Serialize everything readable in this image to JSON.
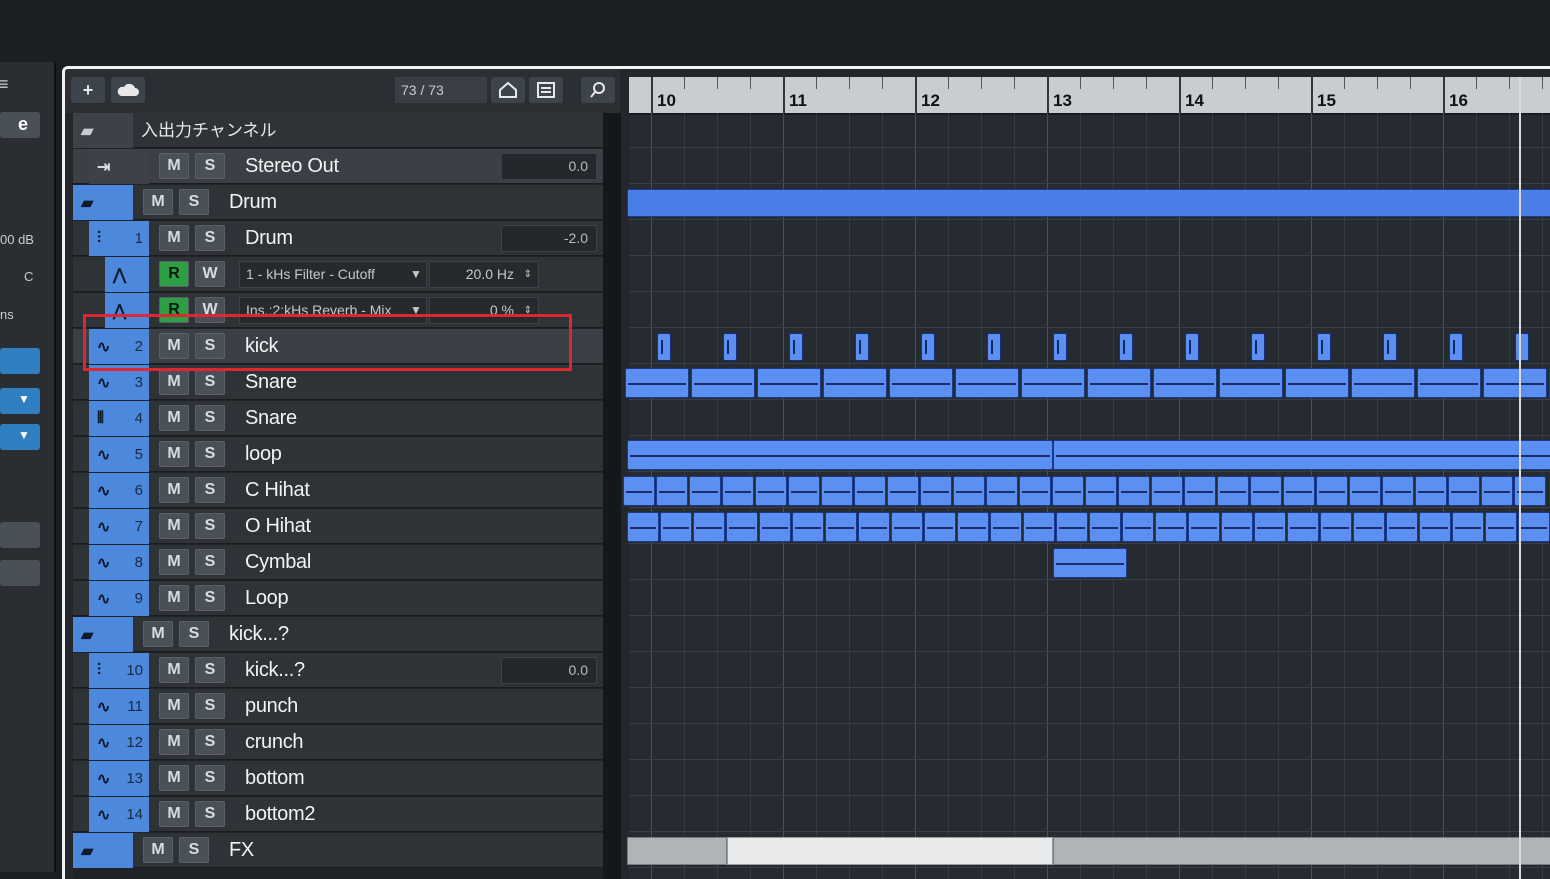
{
  "toolbar": {
    "add_label": "+",
    "track_counter": "73 / 73"
  },
  "inspector": {
    "db_text": "00 dB",
    "c_text": "C",
    "ns_text": "ns"
  },
  "tracks": [
    {
      "num": "",
      "name": "入出力チャンネル",
      "type": "io-folder"
    },
    {
      "num": "",
      "name": "Stereo Out",
      "type": "output",
      "value": "0.0",
      "m": "M",
      "s": "S"
    },
    {
      "num": "",
      "name": "Drum",
      "type": "folder",
      "m": "M",
      "s": "S"
    },
    {
      "num": "1",
      "name": "Drum",
      "type": "group",
      "value": "-2.0",
      "m": "M",
      "s": "S"
    },
    {
      "num": "",
      "name": "1 - kHs Filter - Cutoff",
      "type": "automation",
      "value": "20.0 Hz",
      "r": "R",
      "w": "W"
    },
    {
      "num": "",
      "name": "Ins.:2:kHs Reverb - Mix",
      "type": "automation",
      "value": "0 %",
      "r": "R",
      "w": "W"
    },
    {
      "num": "2",
      "name": "kick",
      "type": "audio",
      "m": "M",
      "s": "S"
    },
    {
      "num": "3",
      "name": "Snare",
      "type": "audio",
      "m": "M",
      "s": "S"
    },
    {
      "num": "4",
      "name": "Snare",
      "type": "instrument",
      "m": "M",
      "s": "S"
    },
    {
      "num": "5",
      "name": "loop",
      "type": "audio",
      "m": "M",
      "s": "S"
    },
    {
      "num": "6",
      "name": "C Hihat",
      "type": "audio",
      "m": "M",
      "s": "S"
    },
    {
      "num": "7",
      "name": "O Hihat",
      "type": "audio",
      "m": "M",
      "s": "S"
    },
    {
      "num": "8",
      "name": "Cymbal",
      "type": "audio",
      "m": "M",
      "s": "S"
    },
    {
      "num": "9",
      "name": "Loop",
      "type": "audio",
      "m": "M",
      "s": "S"
    },
    {
      "num": "",
      "name": "kick...?",
      "type": "folder",
      "m": "M",
      "s": "S"
    },
    {
      "num": "10",
      "name": "kick...?",
      "type": "group",
      "value": "0.0",
      "m": "M",
      "s": "S"
    },
    {
      "num": "11",
      "name": "punch",
      "type": "audio",
      "m": "M",
      "s": "S"
    },
    {
      "num": "12",
      "name": "crunch",
      "type": "audio",
      "m": "M",
      "s": "S"
    },
    {
      "num": "13",
      "name": "bottom",
      "type": "audio",
      "m": "M",
      "s": "S"
    },
    {
      "num": "14",
      "name": "bottom2",
      "type": "audio",
      "m": "M",
      "s": "S"
    },
    {
      "num": "",
      "name": "FX",
      "type": "folder",
      "m": "M",
      "s": "S"
    }
  ],
  "ruler": {
    "bars": [
      "10",
      "11",
      "12",
      "13",
      "14",
      "15",
      "16"
    ]
  },
  "colors": {
    "track_icon_bg": "#4c88dc",
    "event_blue": "#4a7fe8",
    "read_green": "#2ea043",
    "highlight_red": "#e0272f"
  }
}
